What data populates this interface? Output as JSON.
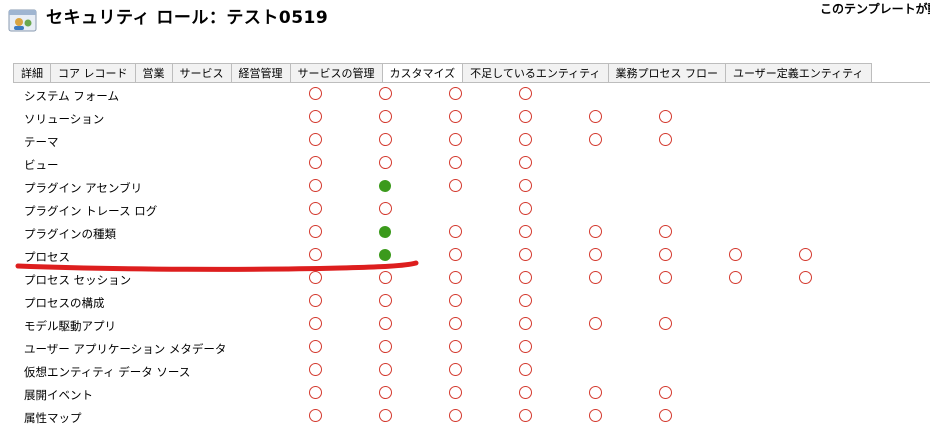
{
  "header": {
    "title": "セキュリティ ロール：テスト0519",
    "top_right_text": "このテンプレートが動作"
  },
  "tabs": [
    {
      "label": "詳細"
    },
    {
      "label": "コア レコード"
    },
    {
      "label": "営業"
    },
    {
      "label": "サービス"
    },
    {
      "label": "経営管理"
    },
    {
      "label": "サービスの管理"
    },
    {
      "label": "カスタマイズ",
      "active": true
    },
    {
      "label": "不足しているエンティティ"
    },
    {
      "label": "業務プロセス フロー"
    },
    {
      "label": "ユーザー定義エンティティ"
    }
  ],
  "colors": {
    "empty_circle": "#d43a2f",
    "filled_circle": "#3b9a1c",
    "annotation_line": "#dd1e1e"
  },
  "legend_states": {
    "o": "empty circle (none)",
    "f": "filled green circle (granted)"
  },
  "rows": [
    {
      "label": "システム フォーム",
      "cells": [
        "o",
        "o",
        "o",
        "o",
        "",
        "",
        "",
        ""
      ]
    },
    {
      "label": "ソリューション",
      "cells": [
        "o",
        "o",
        "o",
        "o",
        "o",
        "o",
        "",
        ""
      ]
    },
    {
      "label": "テーマ",
      "cells": [
        "o",
        "o",
        "o",
        "o",
        "o",
        "o",
        "",
        ""
      ]
    },
    {
      "label": "ビュー",
      "cells": [
        "o",
        "o",
        "o",
        "o",
        "",
        "",
        "",
        ""
      ]
    },
    {
      "label": "プラグイン アセンブリ",
      "cells": [
        "o",
        "f",
        "o",
        "o",
        "",
        "",
        "",
        ""
      ]
    },
    {
      "label": "プラグイン トレース ログ",
      "cells": [
        "o",
        "o",
        "",
        "o",
        "",
        "",
        "",
        ""
      ]
    },
    {
      "label": "プラグインの種類",
      "cells": [
        "o",
        "f",
        "o",
        "o",
        "o",
        "o",
        "",
        ""
      ]
    },
    {
      "label": "プロセス",
      "cells": [
        "o",
        "f",
        "o",
        "o",
        "o",
        "o",
        "o",
        "o"
      ]
    },
    {
      "label": "プロセス セッション",
      "cells": [
        "o",
        "o",
        "o",
        "o",
        "o",
        "o",
        "o",
        "o"
      ]
    },
    {
      "label": "プロセスの構成",
      "cells": [
        "o",
        "o",
        "o",
        "o",
        "",
        "",
        "",
        ""
      ]
    },
    {
      "label": "モデル駆動アプリ",
      "cells": [
        "o",
        "o",
        "o",
        "o",
        "o",
        "o",
        "",
        ""
      ]
    },
    {
      "label": "ユーザー アプリケーション メタデータ",
      "cells": [
        "o",
        "o",
        "o",
        "o",
        "",
        "",
        "",
        ""
      ]
    },
    {
      "label": "仮想エンティティ データ ソース",
      "cells": [
        "o",
        "o",
        "o",
        "o",
        "",
        "",
        "",
        ""
      ]
    },
    {
      "label": "展開イベント",
      "cells": [
        "o",
        "o",
        "o",
        "o",
        "o",
        "o",
        "",
        ""
      ]
    },
    {
      "label": "属性マップ",
      "cells": [
        "o",
        "o",
        "o",
        "o",
        "o",
        "o",
        "",
        ""
      ]
    }
  ]
}
